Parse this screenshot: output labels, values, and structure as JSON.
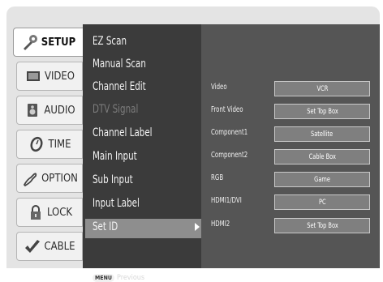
{
  "tabs": [
    {
      "label": "SETUP",
      "icon": "setup-icon",
      "active": true
    },
    {
      "label": "VIDEO",
      "icon": "video-icon",
      "active": false
    },
    {
      "label": "AUDIO",
      "icon": "audio-icon",
      "active": false
    },
    {
      "label": "TIME",
      "icon": "time-icon",
      "active": false
    },
    {
      "label": "OPTION",
      "icon": "option-icon",
      "active": false
    },
    {
      "label": "LOCK",
      "icon": "lock-icon",
      "active": false
    },
    {
      "label": "CABLE",
      "icon": "cable-icon",
      "active": false
    }
  ],
  "menu": {
    "items": [
      {
        "label": "EZ Scan",
        "disabled": false
      },
      {
        "label": "Manual Scan",
        "disabled": false
      },
      {
        "label": "Channel Edit",
        "disabled": false
      },
      {
        "label": "DTV Signal",
        "disabled": true
      },
      {
        "label": "Channel Label",
        "disabled": false
      },
      {
        "label": "Main Input",
        "disabled": false
      },
      {
        "label": "Sub Input",
        "disabled": false
      },
      {
        "label": "Input Label",
        "disabled": false,
        "selected": true
      },
      {
        "label": "Set ID",
        "disabled": false
      }
    ],
    "hint_key": "MENU",
    "hint_text": "Previous"
  },
  "input_labels": [
    {
      "input": "Video",
      "value": "VCR"
    },
    {
      "input": "Front Video",
      "value": "Set Top Box"
    },
    {
      "input": "Component1",
      "value": "Satellite"
    },
    {
      "input": "Component2",
      "value": "Cable Box"
    },
    {
      "input": "RGB",
      "value": "Game"
    },
    {
      "input": "HDMI1/DVI",
      "value": "PC"
    },
    {
      "input": "HDMI2",
      "value": "Set Top Box"
    }
  ],
  "colors": {
    "menu_bg": "#3b3b3b",
    "sub_bg": "#555555",
    "selected_bg": "#8e8e8e",
    "tab_bg": "#f1f1f1"
  }
}
